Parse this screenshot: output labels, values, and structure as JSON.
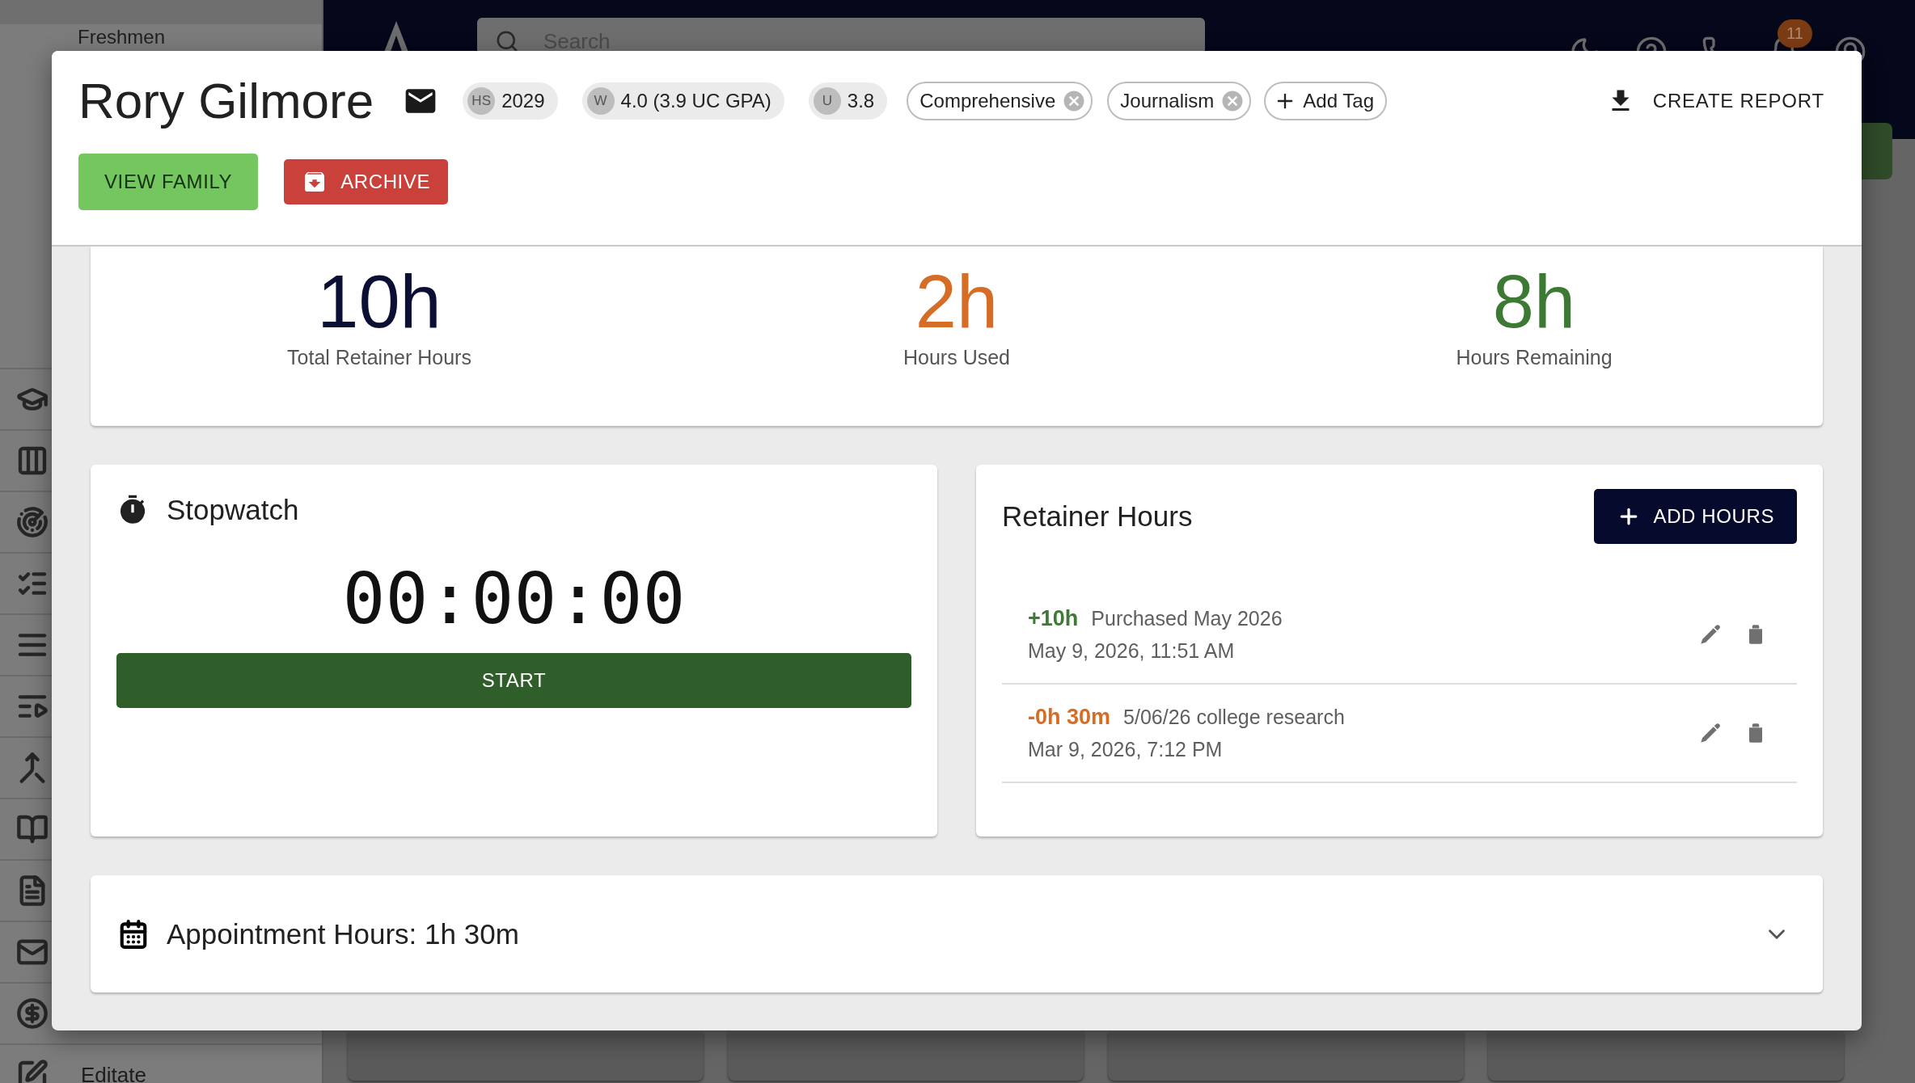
{
  "background": {
    "sidebar": {
      "items": [
        {
          "label": "Freshmen"
        }
      ],
      "footer_item": {
        "label": "Editate"
      }
    },
    "search": {
      "placeholder": "Search"
    },
    "notifications": {
      "count": "11"
    }
  },
  "student": {
    "name": "Rory Gilmore",
    "chips": [
      {
        "prefix": "HS",
        "value": "2029"
      },
      {
        "prefix": "W",
        "value": "4.0 (3.9 UC GPA)"
      },
      {
        "prefix": "U",
        "value": "3.8"
      }
    ],
    "tags": [
      {
        "label": "Comprehensive"
      },
      {
        "label": "Journalism"
      }
    ],
    "add_tag": "Add Tag",
    "create_report": "CREATE REPORT",
    "view_family": "VIEW FAMILY",
    "archive": "ARCHIVE"
  },
  "summary": [
    {
      "value": "10h",
      "label": "Total Retainer Hours",
      "kind": "total"
    },
    {
      "value": "2h",
      "label": "Hours Used",
      "kind": "used"
    },
    {
      "value": "8h",
      "label": "Hours Remaining",
      "kind": "remaining"
    }
  ],
  "stopwatch": {
    "title": "Stopwatch",
    "time": "00:00:00",
    "start": "START"
  },
  "retainer": {
    "title": "Retainer Hours",
    "add": "ADD HOURS",
    "entries": [
      {
        "amount": "+10h",
        "kind": "credit",
        "note": "Purchased May 2026",
        "date": "May 9, 2026, 11:51 AM"
      },
      {
        "amount": "-0h 30m",
        "kind": "debit",
        "note": "5/06/26 college research",
        "date": "Mar 9, 2026, 7:12 PM"
      }
    ]
  },
  "appointments": {
    "title": "Appointment Hours: 1h 30m",
    "expanded": false
  }
}
